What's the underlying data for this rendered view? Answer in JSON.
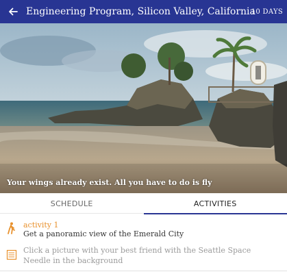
{
  "appbar": {
    "title": "Engineering Program, Silicon Valley, California",
    "days": "10 DAYS",
    "back_icon": "arrow-left-icon"
  },
  "hero": {
    "caption": "Your wings already exist. All you have to do is fly"
  },
  "tabs": [
    {
      "label": "SCHEDULE",
      "active": false
    },
    {
      "label": "ACTIVITIES",
      "active": true
    }
  ],
  "activities": [
    {
      "label": "activity 1",
      "text": "Get a panoramic view of the Emerald City",
      "icon": "hiking-person-icon"
    },
    {
      "text": "Click a picture with your best friend with the Seattle Space Needle in the background",
      "icon": "notes-list-icon"
    }
  ],
  "colors": {
    "appbar": "#283593",
    "accent": "#e8912d"
  }
}
